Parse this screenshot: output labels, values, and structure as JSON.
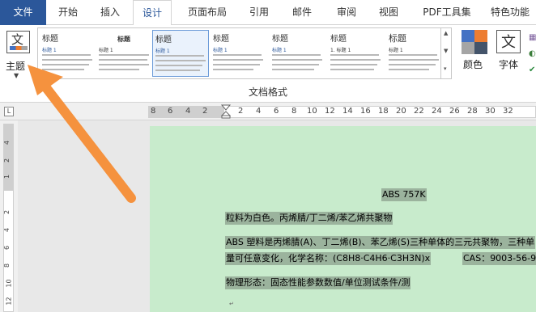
{
  "tabs": [
    {
      "label": "文件"
    },
    {
      "label": "开始"
    },
    {
      "label": "插入"
    },
    {
      "label": "设计"
    },
    {
      "label": "页面布局"
    },
    {
      "label": "引用"
    },
    {
      "label": "邮件"
    },
    {
      "label": "审阅"
    },
    {
      "label": "视图"
    },
    {
      "label": "PDF工具集"
    },
    {
      "label": "特色功能"
    }
  ],
  "ribbon": {
    "theme_label": "主题",
    "theme_glyph": "文",
    "colors_label": "颜色",
    "fonts_label": "字体",
    "fonts_glyph": "文",
    "group_label": "文档格式",
    "styles": [
      {
        "title": "标题",
        "sub": "标题 1"
      },
      {
        "title": "标题",
        "sub": "标题 1"
      },
      {
        "title": "标题",
        "sub": "标题 1"
      },
      {
        "title": "标题",
        "sub": "标题 1"
      },
      {
        "title": "标题",
        "sub": "标题 1"
      },
      {
        "title": "标题",
        "sub": "1. 标题 1"
      },
      {
        "title": "标题",
        "sub": "标题 1"
      }
    ]
  },
  "ruler": {
    "corner_glyph": "L",
    "h_numbers": [
      "8",
      "6",
      "4",
      "2",
      "2",
      "4",
      "6",
      "8",
      "10",
      "12",
      "14",
      "16",
      "18",
      "20",
      "22",
      "24",
      "26",
      "28",
      "30",
      "32"
    ],
    "v_numbers": [
      "4",
      "2",
      "1",
      "2",
      "4",
      "6",
      "8",
      "10",
      "12"
    ]
  },
  "document": {
    "lines": [
      "ABS 757K",
      "粒料为白色。丙烯腈/丁二烯/苯乙烯共聚物",
      "ABS 塑料是丙烯腈(A)、丁二烯(B)、苯乙烯(S)三种单体的三元共聚物，三种单",
      "量可任意变化，化学名称：(C8H8·C4H6·C3H3N)x",
      "CAS：9003-56-9",
      "物理形态：固态性能参数数值/单位测试条件/测"
    ]
  },
  "colors": {
    "file_tab": "#2b579a",
    "page_bg": "#c8ebcc",
    "highlight": "#9bb39d",
    "arrow": "#f5923e"
  }
}
